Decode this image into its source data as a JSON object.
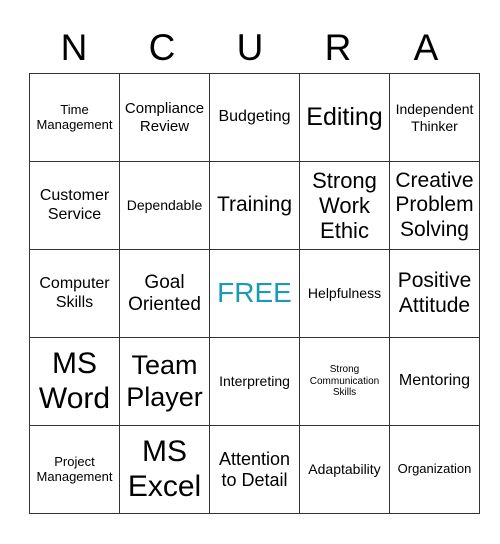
{
  "header": [
    "N",
    "C",
    "U",
    "R",
    "A"
  ],
  "free_color": "#1a9bb5",
  "cells": [
    [
      {
        "t": "Time Management",
        "s": 13
      },
      {
        "t": "Compliance Review",
        "s": 15
      },
      {
        "t": "Budgeting",
        "s": 16
      },
      {
        "t": "Editing",
        "s": 25
      },
      {
        "t": "Independent Thinker",
        "s": 14
      }
    ],
    [
      {
        "t": "Customer Service",
        "s": 16
      },
      {
        "t": "Dependable",
        "s": 14
      },
      {
        "t": "Training",
        "s": 21
      },
      {
        "t": "Strong Work Ethic",
        "s": 22
      },
      {
        "t": "Creative Problem Solving",
        "s": 21
      }
    ],
    [
      {
        "t": "Computer Skills",
        "s": 16
      },
      {
        "t": "Goal Oriented",
        "s": 19
      },
      {
        "t": "FREE",
        "s": 28,
        "free": true
      },
      {
        "t": "Helpfulness",
        "s": 14
      },
      {
        "t": "Positive Attitude",
        "s": 21
      }
    ],
    [
      {
        "t": "MS Word",
        "s": 30
      },
      {
        "t": "Team Player",
        "s": 27
      },
      {
        "t": "Interpreting",
        "s": 14
      },
      {
        "t": "Strong Communication Skills",
        "s": 10
      },
      {
        "t": "Mentoring",
        "s": 16
      }
    ],
    [
      {
        "t": "Project Management",
        "s": 13
      },
      {
        "t": "MS Excel",
        "s": 30
      },
      {
        "t": "Attention to Detail",
        "s": 18
      },
      {
        "t": "Adaptability",
        "s": 14
      },
      {
        "t": "Organization",
        "s": 13
      }
    ]
  ]
}
